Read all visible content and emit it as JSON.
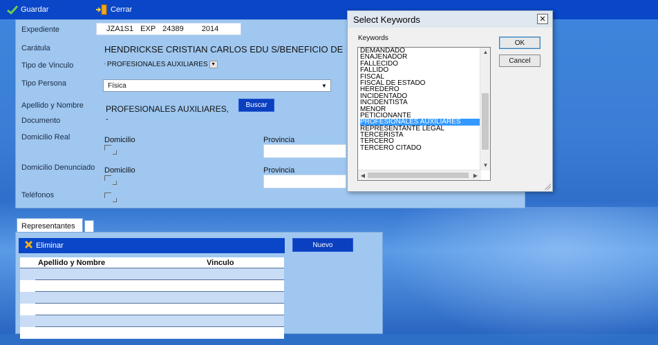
{
  "toolbar": {
    "guardar_label": "Guardar",
    "cerrar_label": "Cerrar"
  },
  "form": {
    "expediente_label": "Expediente",
    "expediente_code": "JZA1S1",
    "expediente_exp": "EXP",
    "expediente_num": "24389",
    "expediente_year": "2014",
    "caratula_label": "Carátula",
    "caratula_value": "HENDRICKSE CRISTIAN CARLOS EDU S/BENEFICIO DE LITIG",
    "tipo_vinculo_label": "Tipo de Vinculo",
    "tipo_vinculo_value": "PROFESIONALES AUXILIARES",
    "tipo_persona_label": "Tipo Persona",
    "tipo_persona_value": "Física",
    "apellido_label": "Apellido y Nombre",
    "apellido_value": "PROFESIONALES AUXILIARES,",
    "buscar_label": "Buscar",
    "documento_label": "Documento",
    "documento_value": "-",
    "domicilio_real_label": "Domicilio Real",
    "domicilio_denunciado_label": "Domicilio Denunciado",
    "domicilio_sub_label": "Domicilio",
    "provincia_label": "Provincia",
    "telefonos_label": "Teléfonos"
  },
  "representantes": {
    "tab_label": "Representantes",
    "eliminar_label": "Eliminar",
    "nuevo_label": "Nuevo",
    "columns": [
      "Apellido y Nombre",
      "Vinculo"
    ]
  },
  "dialog": {
    "title": "Select Keywords",
    "keywords_label": "Keywords",
    "ok_label": "OK",
    "cancel_label": "Cancel",
    "items": [
      "DEMANDADO",
      "ENAJENADOR",
      "FALLECIDO",
      "FALLIDO",
      "FISCAL",
      "FISCAL DE ESTADO",
      "HEREDERO",
      "INCIDENTADO",
      "INCIDENTISTA",
      "MENOR",
      "PETICIONANTE",
      "PROFESIONALES AUXILIARES",
      "REPRESENTANTE LEGAL",
      "TERCERISTA",
      "TERCERO",
      "TERCERO CITADO"
    ],
    "selected": "PROFESIONALES AUXILIARES"
  },
  "colors": {
    "toolbar": "#0a46c8",
    "panel": "#9fc7f0",
    "selection": "#3399ff"
  }
}
